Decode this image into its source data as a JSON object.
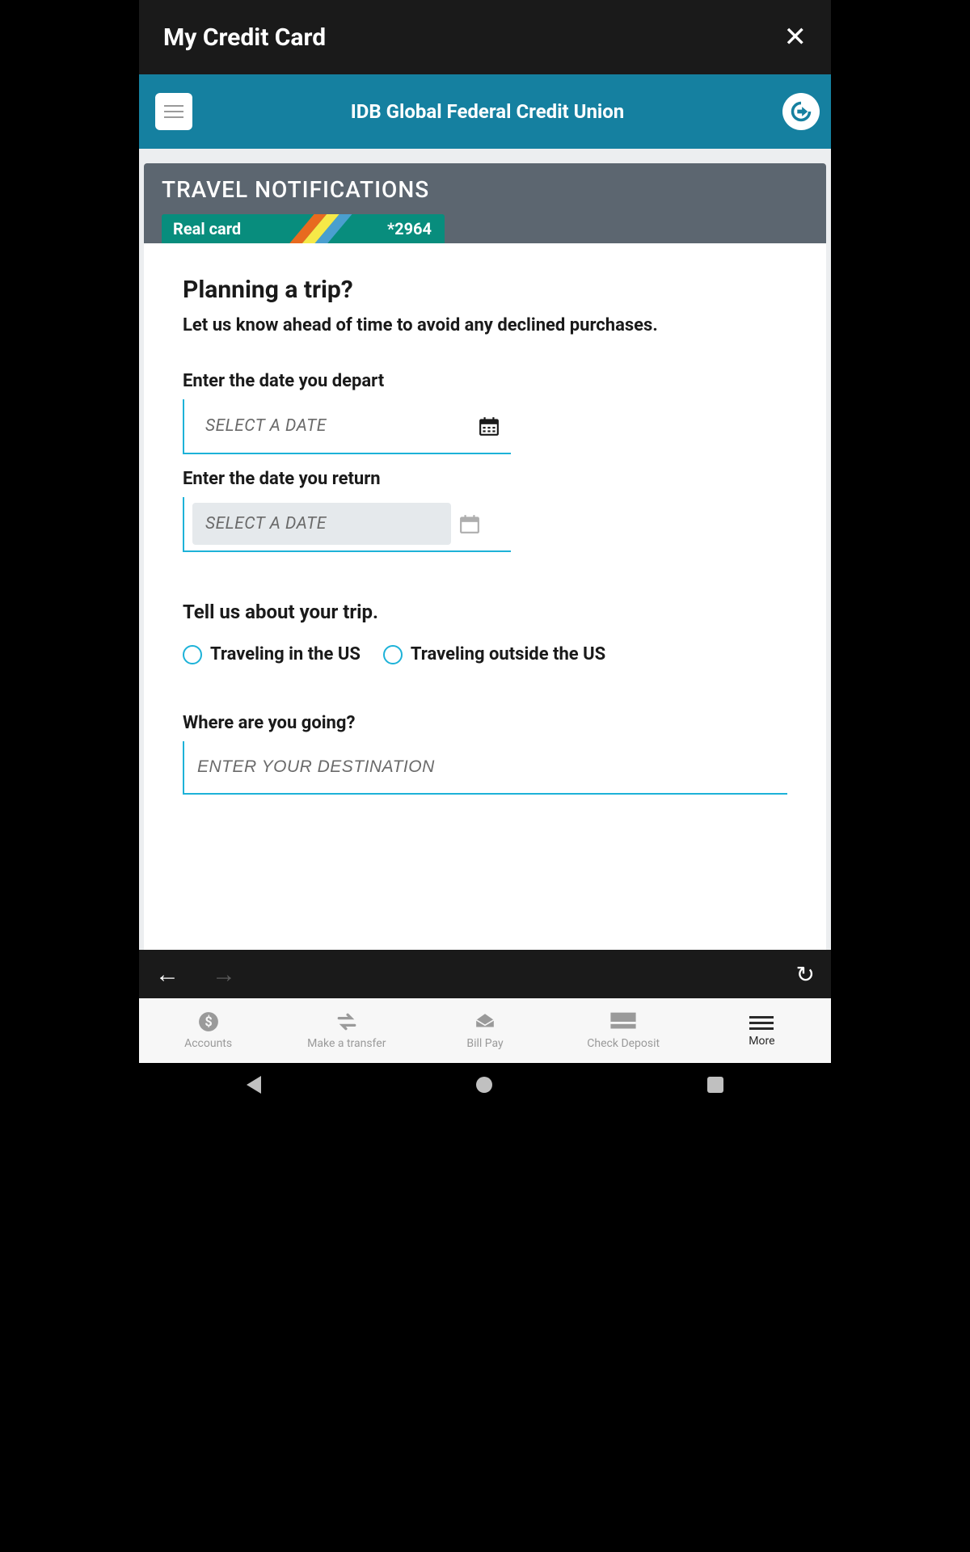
{
  "titlebar": {
    "title": "My Credit Card"
  },
  "header": {
    "title": "IDB Global Federal Credit Union"
  },
  "page": {
    "heading": "TRAVEL NOTIFICATIONS",
    "card": {
      "label": "Real card",
      "last4": "*2964"
    },
    "form": {
      "title": "Planning a trip?",
      "subtitle": "Let us know ahead of time to avoid any declined purchases.",
      "depart_label": "Enter the date you depart",
      "depart_placeholder": "SELECT A DATE",
      "return_label": "Enter the date you return",
      "return_placeholder": "SELECT A DATE",
      "trip_section_label": "Tell us about your trip.",
      "options": [
        {
          "label": "Traveling in the US"
        },
        {
          "label": "Traveling outside the US"
        }
      ],
      "where_label": "Where are you going?",
      "where_placeholder": "ENTER YOUR DESTINATION"
    }
  },
  "tabs": [
    {
      "label": "Accounts"
    },
    {
      "label": "Make a transfer"
    },
    {
      "label": "Bill Pay"
    },
    {
      "label": "Check Deposit"
    },
    {
      "label": "More"
    }
  ]
}
